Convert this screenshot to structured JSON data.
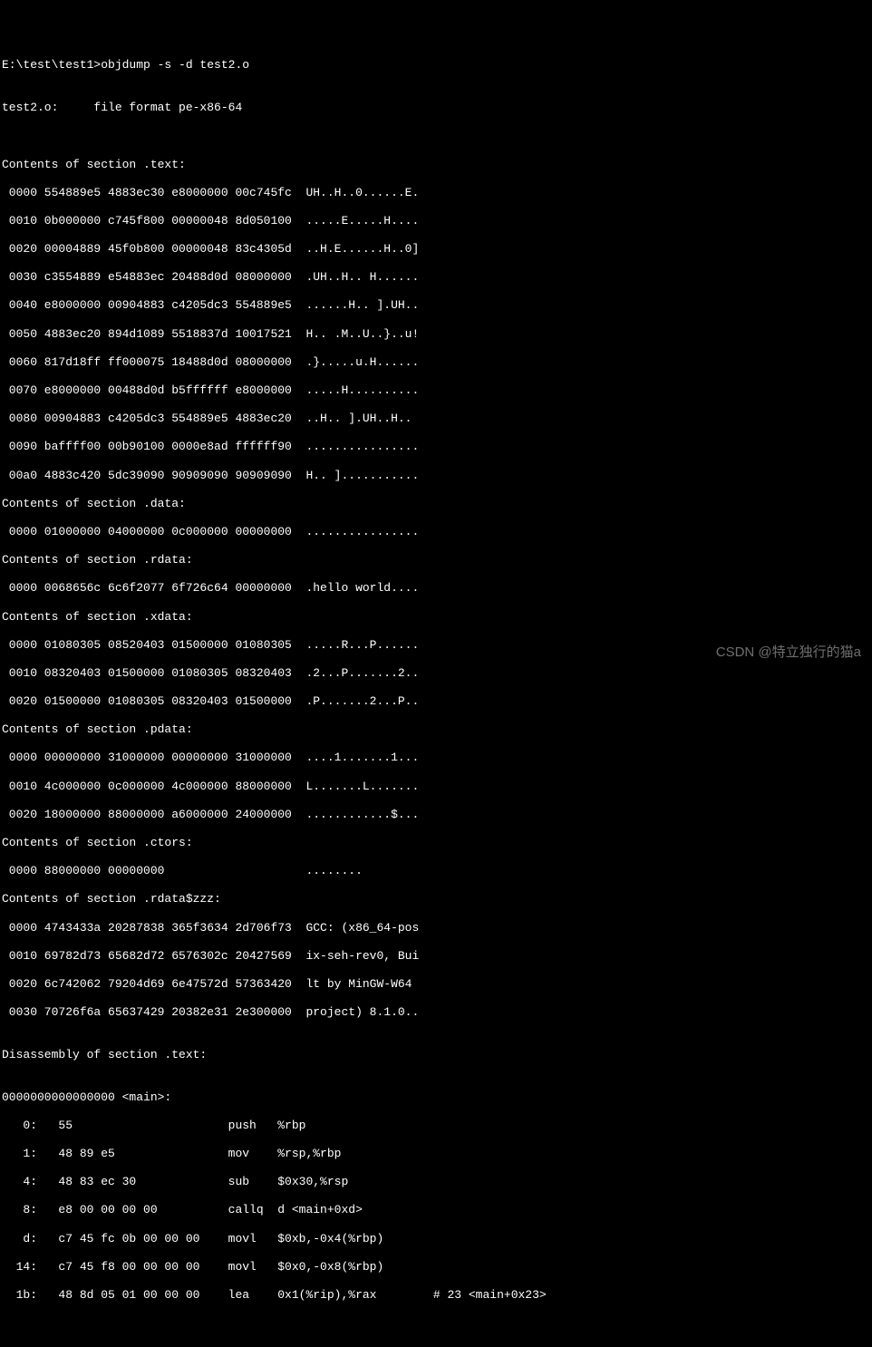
{
  "prompt": "E:\\test\\test1>objdump -s -d test2.o",
  "blank1": "",
  "file_header": "test2.o:     file format pe-x86-64",
  "blank2": "",
  "blank3": "",
  "text_header": "Contents of section .text:",
  "text_lines": [
    " 0000 554889e5 4883ec30 e8000000 00c745fc  UH..H..0......E.",
    " 0010 0b000000 c745f800 00000048 8d050100  .....E.....H....",
    " 0020 00004889 45f0b800 00000048 83c4305d  ..H.E......H..0]",
    " 0030 c3554889 e54883ec 20488d0d 08000000  .UH..H.. H......",
    " 0040 e8000000 00904883 c4205dc3 554889e5  ......H.. ].UH..",
    " 0050 4883ec20 894d1089 5518837d 10017521  H.. .M..U..}..u!",
    " 0060 817d18ff ff000075 18488d0d 08000000  .}.....u.H......",
    " 0070 e8000000 00488d0d b5ffffff e8000000  .....H..........",
    " 0080 00904883 c4205dc3 554889e5 4883ec20  ..H.. ].UH..H.. ",
    " 0090 baffff00 00b90100 0000e8ad ffffff90  ................",
    " 00a0 4883c420 5dc39090 90909090 90909090  H.. ]..........."
  ],
  "data_header": "Contents of section .data:",
  "data_lines": [
    " 0000 01000000 04000000 0c000000 00000000  ................"
  ],
  "rdata_header": "Contents of section .rdata:",
  "rdata_lines": [
    " 0000 0068656c 6c6f2077 6f726c64 00000000  .hello world...."
  ],
  "xdata_header": "Contents of section .xdata:",
  "xdata_lines": [
    " 0000 01080305 08520403 01500000 01080305  .....R...P......",
    " 0010 08320403 01500000 01080305 08320403  .2...P.......2..",
    " 0020 01500000 01080305 08320403 01500000  .P.......2...P.."
  ],
  "pdata_header": "Contents of section .pdata:",
  "pdata_lines": [
    " 0000 00000000 31000000 00000000 31000000  ....1.......1...",
    " 0010 4c000000 0c000000 4c000000 88000000  L.......L.......",
    " 0020 18000000 88000000 a6000000 24000000  ............$..."
  ],
  "ctors_header": "Contents of section .ctors:",
  "ctors_lines": [
    " 0000 88000000 00000000                    ........"
  ],
  "rdatazzz_header": "Contents of section .rdata$zzz:",
  "rdatazzz_lines": [
    " 0000 4743433a 20287838 365f3634 2d706f73  GCC: (x86_64-pos",
    " 0010 69782d73 65682d72 6576302c 20427569  ix-seh-rev0, Bui",
    " 0020 6c742062 79204d69 6e47572d 57363420  lt by MinGW-W64 ",
    " 0030 70726f6a 65637429 20382e31 2e300000  project) 8.1.0.."
  ],
  "blank4": "",
  "disasm_header": "Disassembly of section .text:",
  "blank5": "",
  "func_label": "0000000000000000 <main>:",
  "disasm_lines": [
    "   0:   55                      push   %rbp",
    "   1:   48 89 e5                mov    %rsp,%rbp",
    "   4:   48 83 ec 30             sub    $0x30,%rsp",
    "   8:   e8 00 00 00 00          callq  d <main+0xd>",
    "   d:   c7 45 fc 0b 00 00 00    movl   $0xb,-0x4(%rbp)",
    "  14:   c7 45 f8 00 00 00 00    movl   $0x0,-0x8(%rbp)",
    "  1b:   48 8d 05 01 00 00 00    lea    0x1(%rip),%rax        # 23 <main+0x23>"
  ],
  "watermark": "CSDN @特立独行的猫a"
}
